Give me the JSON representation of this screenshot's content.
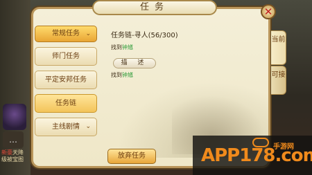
{
  "window": {
    "title": "任务",
    "close_symbol": "✕"
  },
  "sidebar": {
    "items": [
      {
        "label": "常规任务",
        "state": "active",
        "chevron": "⌄"
      },
      {
        "label": "师门任务",
        "state": "normal"
      },
      {
        "label": "平定安邦任务",
        "state": "normal"
      },
      {
        "label": "任务链",
        "state": "selected"
      },
      {
        "label": "主线剧情",
        "state": "normal",
        "chevron": "⌄"
      }
    ]
  },
  "tabs": [
    {
      "label": "当前",
      "active": true
    },
    {
      "label": "可接",
      "active": false
    }
  ],
  "quest": {
    "title": "任务链-寻人(56/300)",
    "find_prefix": "找到",
    "npc_name": "钟馗",
    "desc_label": "描 述"
  },
  "actions": {
    "abandon_label": "放弃任务"
  },
  "left_hud": {
    "line1_red": "新豪",
    "line1_rest": "天降",
    "line2": "级被宝图"
  },
  "watermark": {
    "brand": "APP178.com",
    "sub": "手游网"
  },
  "colors": {
    "npc_green": "#2f9c3a",
    "accent_gold": "#e8a534",
    "close_red": "#c21e1e"
  }
}
